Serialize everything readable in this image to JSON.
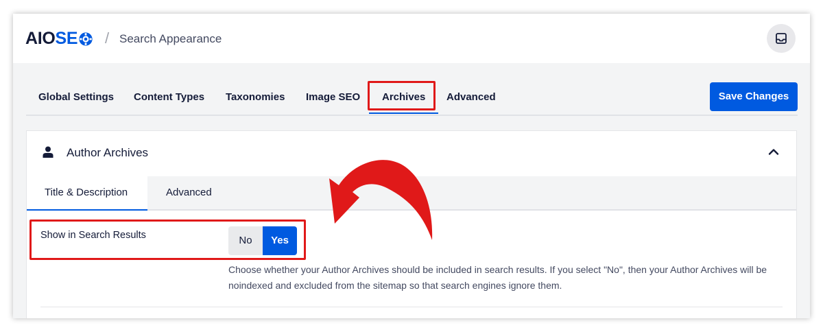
{
  "header": {
    "logo_aio": "AIO",
    "logo_seo": "SE",
    "breadcrumb_separator": "/",
    "breadcrumb_title": "Search Appearance",
    "notification_icon": "inbox-icon"
  },
  "tabs": [
    {
      "label": "Global Settings"
    },
    {
      "label": "Content Types"
    },
    {
      "label": "Taxonomies"
    },
    {
      "label": "Image SEO"
    },
    {
      "label": "Archives"
    },
    {
      "label": "Advanced"
    }
  ],
  "active_tab": "Archives",
  "save_button": "Save Changes",
  "card": {
    "title": "Author Archives",
    "icon": "user-icon",
    "collapse_icon": "chevron-up-icon",
    "subtabs": [
      {
        "label": "Title & Description"
      },
      {
        "label": "Advanced"
      }
    ],
    "active_subtab": "Title & Description",
    "setting": {
      "label": "Show in Search Results",
      "option_no": "No",
      "option_yes": "Yes",
      "selected": "Yes",
      "description": "Choose whether your Author Archives should be included in search results. If you select \"No\", then your Author Archives will be noindexed and excluded from the sitemap so that search engines ignore them."
    }
  },
  "colors": {
    "accent": "#005ae0",
    "highlight": "#e01919",
    "text": "#141b38"
  }
}
